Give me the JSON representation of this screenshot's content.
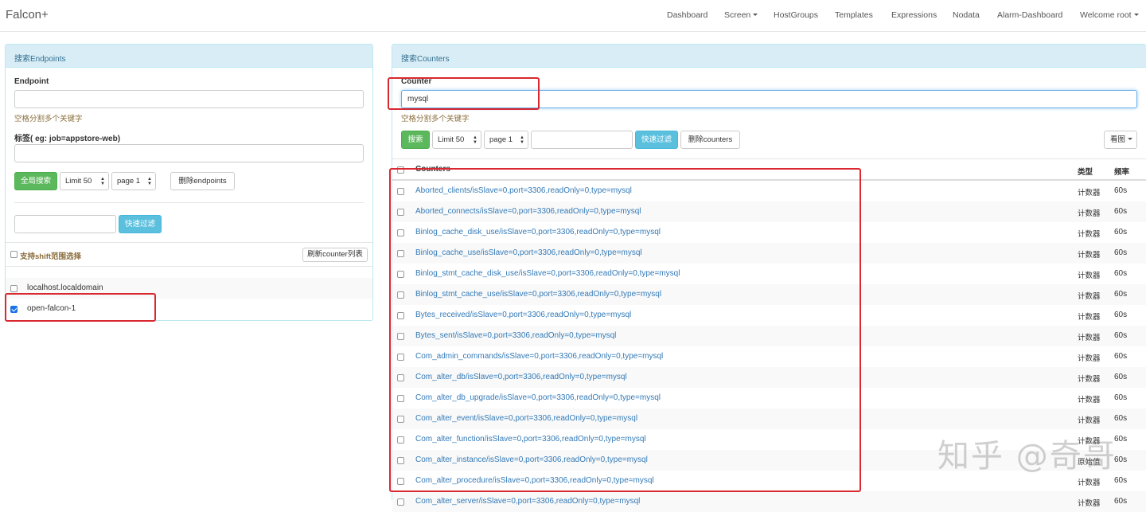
{
  "navbar": {
    "brand": "Falcon+",
    "items": [
      "Dashboard",
      "Screen",
      "HostGroups",
      "Templates",
      "Expressions",
      "Nodata",
      "Alarm-Dashboard",
      "Welcome root"
    ]
  },
  "left_panel": {
    "heading": "搜索Endpoints",
    "endpoint_label": "Endpoint",
    "endpoint_value": "",
    "endpoint_hint": "空格分割多个关键字",
    "tag_label": "标签( eg: job=appstore-web)",
    "tag_value": "",
    "global_search_button": "全局搜索",
    "limit_select": "Limit 50",
    "page_select": "page 1",
    "delete_endpoints_button": "删除endpoints",
    "filter_value": "",
    "quick_filter_button": "快速过滤",
    "shift_select_label": "支持shift范围选择",
    "refresh_counter_button": "刷新counter列表",
    "endpoints": [
      {
        "name": "localhost.localdomain",
        "checked": false
      },
      {
        "name": "open-falcon-1",
        "checked": true
      }
    ]
  },
  "right_panel": {
    "heading": "搜索Counters",
    "counter_label": "Counter",
    "counter_value": "mysql",
    "counter_hint": "空格分割多个关键字",
    "search_button": "搜索",
    "limit_select": "Limit 50",
    "page_select": "page 1",
    "filter_value": "",
    "quick_filter_button": "快速过滤",
    "delete_counters_button": "删除counters",
    "view_graph_button": "看图",
    "table_headers": [
      "Counters",
      "类型",
      "频率"
    ],
    "rows": [
      {
        "counter": "Aborted_clients/isSlave=0,port=3306,readOnly=0,type=mysql",
        "type": "计数器",
        "step": "60s"
      },
      {
        "counter": "Aborted_connects/isSlave=0,port=3306,readOnly=0,type=mysql",
        "type": "计数器",
        "step": "60s"
      },
      {
        "counter": "Binlog_cache_disk_use/isSlave=0,port=3306,readOnly=0,type=mysql",
        "type": "计数器",
        "step": "60s"
      },
      {
        "counter": "Binlog_cache_use/isSlave=0,port=3306,readOnly=0,type=mysql",
        "type": "计数器",
        "step": "60s"
      },
      {
        "counter": "Binlog_stmt_cache_disk_use/isSlave=0,port=3306,readOnly=0,type=mysql",
        "type": "计数器",
        "step": "60s"
      },
      {
        "counter": "Binlog_stmt_cache_use/isSlave=0,port=3306,readOnly=0,type=mysql",
        "type": "计数器",
        "step": "60s"
      },
      {
        "counter": "Bytes_received/isSlave=0,port=3306,readOnly=0,type=mysql",
        "type": "计数器",
        "step": "60s"
      },
      {
        "counter": "Bytes_sent/isSlave=0,port=3306,readOnly=0,type=mysql",
        "type": "计数器",
        "step": "60s"
      },
      {
        "counter": "Com_admin_commands/isSlave=0,port=3306,readOnly=0,type=mysql",
        "type": "计数器",
        "step": "60s"
      },
      {
        "counter": "Com_alter_db/isSlave=0,port=3306,readOnly=0,type=mysql",
        "type": "计数器",
        "step": "60s"
      },
      {
        "counter": "Com_alter_db_upgrade/isSlave=0,port=3306,readOnly=0,type=mysql",
        "type": "计数器",
        "step": "60s"
      },
      {
        "counter": "Com_alter_event/isSlave=0,port=3306,readOnly=0,type=mysql",
        "type": "计数器",
        "step": "60s"
      },
      {
        "counter": "Com_alter_function/isSlave=0,port=3306,readOnly=0,type=mysql",
        "type": "计数器",
        "step": "60s"
      },
      {
        "counter": "Com_alter_instance/isSlave=0,port=3306,readOnly=0,type=mysql",
        "type": "原始值",
        "step": "60s"
      },
      {
        "counter": "Com_alter_procedure/isSlave=0,port=3306,readOnly=0,type=mysql",
        "type": "计数器",
        "step": "60s"
      },
      {
        "counter": "Com_alter_server/isSlave=0,port=3306,readOnly=0,type=mysql",
        "type": "计数器",
        "step": "60s"
      }
    ]
  },
  "watermark": "知乎 @奇哥",
  "colors": {
    "annotation": "#d9282f",
    "link": "#337ab7",
    "success": "#5cb85c",
    "info": "#5bc0de"
  }
}
